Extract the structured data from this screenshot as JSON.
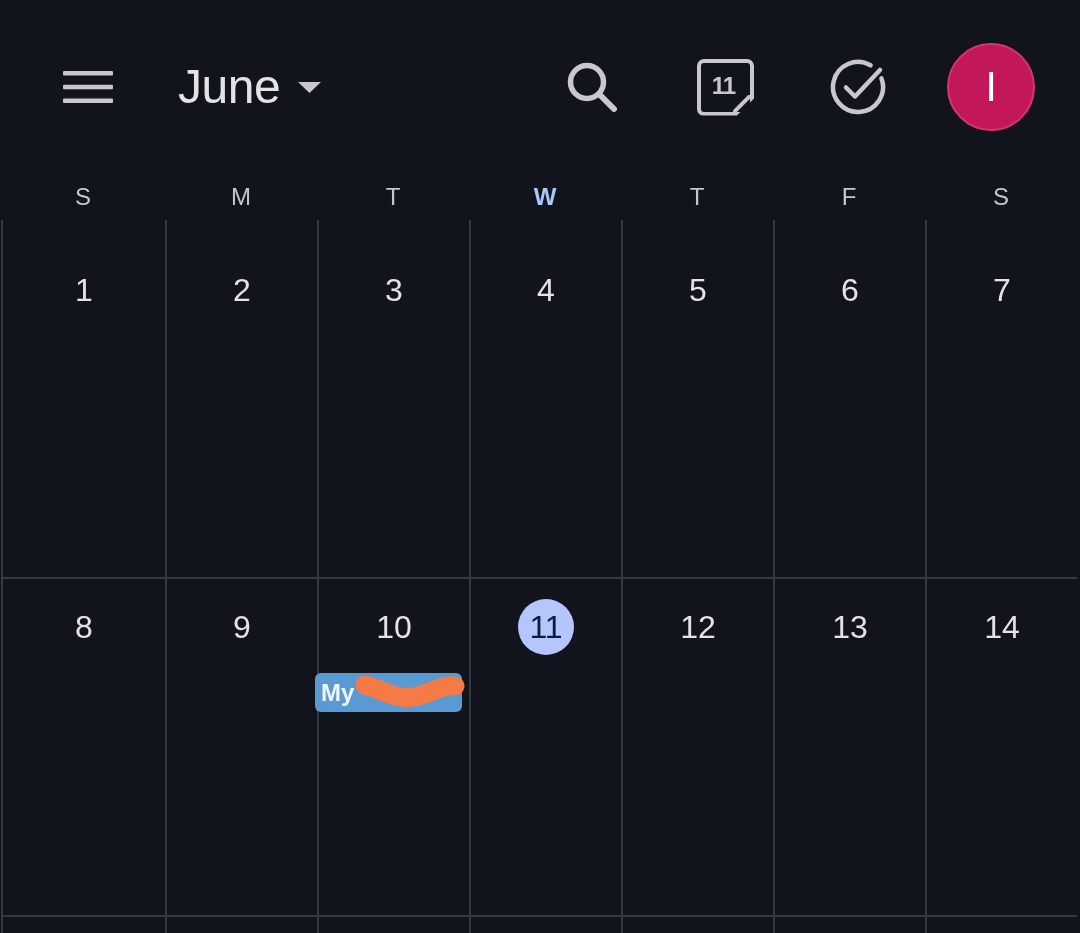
{
  "app_bar": {
    "month": "June",
    "today_button": "11",
    "avatar_initial": "I"
  },
  "weekdays": [
    {
      "label": "S",
      "today": false
    },
    {
      "label": "M",
      "today": false
    },
    {
      "label": "T",
      "today": false
    },
    {
      "label": "W",
      "today": true
    },
    {
      "label": "T",
      "today": false
    },
    {
      "label": "F",
      "today": false
    },
    {
      "label": "S",
      "today": false
    }
  ],
  "weeks": [
    {
      "days": [
        {
          "date": "1",
          "today": false
        },
        {
          "date": "2",
          "today": false
        },
        {
          "date": "3",
          "today": false
        },
        {
          "date": "4",
          "today": false
        },
        {
          "date": "5",
          "today": false
        },
        {
          "date": "6",
          "today": false
        },
        {
          "date": "7",
          "today": false
        }
      ]
    },
    {
      "days": [
        {
          "date": "8",
          "today": false
        },
        {
          "date": "9",
          "today": false
        },
        {
          "date": "10",
          "today": false,
          "events": [
            {
              "title": "My",
              "redacted": true
            }
          ]
        },
        {
          "date": "11",
          "today": true
        },
        {
          "date": "12",
          "today": false
        },
        {
          "date": "13",
          "today": false
        },
        {
          "date": "14",
          "today": false
        }
      ]
    }
  ]
}
